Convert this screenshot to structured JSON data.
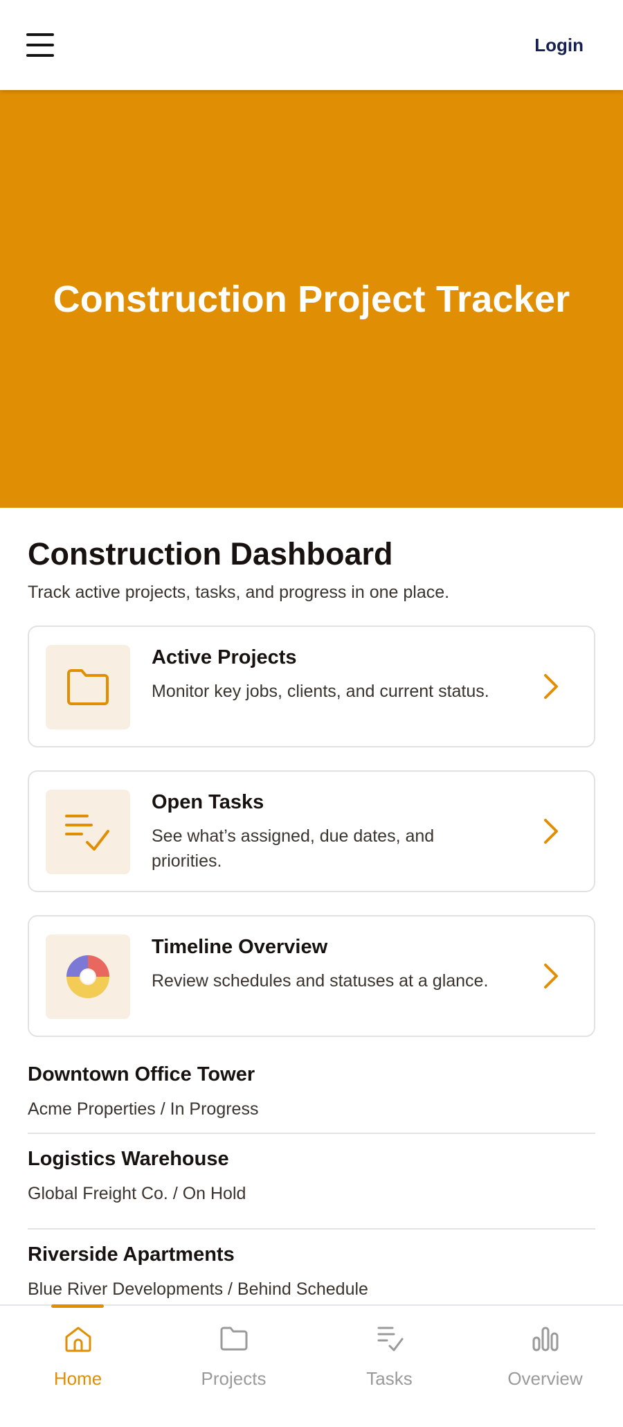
{
  "header": {
    "login_label": "Login"
  },
  "hero": {
    "title": "Construction Project Tracker"
  },
  "dashboard": {
    "title": "Construction Dashboard",
    "subtitle": "Track active projects, tasks, and progress in one place."
  },
  "cards": [
    {
      "title": "Active Projects",
      "description": "Monitor key jobs, clients, and current status.",
      "icon": "folder-icon"
    },
    {
      "title": "Open Tasks",
      "description": "See what’s assigned, due dates, and priorities.",
      "icon": "checklist-icon"
    },
    {
      "title": "Timeline Overview",
      "description": "Review schedules and statuses at a glance.",
      "icon": "donut-chart-icon"
    }
  ],
  "projects": [
    {
      "name": "Downtown Office Tower",
      "meta": "Acme Properties / In Progress"
    },
    {
      "name": "Logistics Warehouse",
      "meta": "Global Freight Co. / On Hold"
    },
    {
      "name": "Riverside Apartments",
      "meta": "Blue River Developments / Behind Schedule"
    }
  ],
  "bottom_nav": [
    {
      "label": "Home",
      "icon": "home-icon",
      "active": true
    },
    {
      "label": "Projects",
      "icon": "folder-icon",
      "active": false
    },
    {
      "label": "Tasks",
      "icon": "tasks-icon",
      "active": false
    },
    {
      "label": "Overview",
      "icon": "bar-chart-icon",
      "active": false
    }
  ],
  "colors": {
    "accent": "#e08f04",
    "hero_bg": "#e08f04",
    "login_text": "#16214f",
    "icon_bg": "#f8efe2",
    "donut_red": "#e8675e",
    "donut_yellow": "#f2cc55",
    "donut_purple": "#7b78d6",
    "nav_inactive": "#9a9a9a"
  }
}
